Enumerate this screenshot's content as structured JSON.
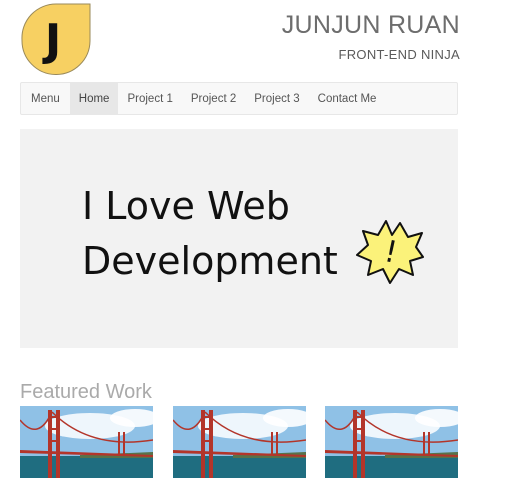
{
  "header": {
    "logo_letter": "J",
    "name": "JUNJUN RUAN",
    "tagline": "FRONT-END NINJA"
  },
  "nav": {
    "brand": "Menu",
    "items": [
      {
        "label": "Home",
        "active": true
      },
      {
        "label": "Project 1"
      },
      {
        "label": "Project 2"
      },
      {
        "label": "Project 3"
      },
      {
        "label": "Contact Me"
      }
    ]
  },
  "hero": {
    "line1": "I Love Web",
    "line2": "Development",
    "burst": "!"
  },
  "featured": {
    "title": "Featured Work",
    "images": [
      {
        "name": "golden-gate-bridge-photo"
      },
      {
        "name": "golden-gate-bridge-photo"
      },
      {
        "name": "golden-gate-bridge-photo"
      }
    ]
  },
  "colors": {
    "logo_yellow": "#f7d062",
    "bridge_red": "#b3352a",
    "water": "#1f6d80",
    "sky": "#8fc1e6"
  }
}
